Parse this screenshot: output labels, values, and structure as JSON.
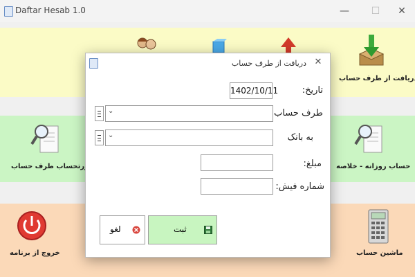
{
  "window": {
    "title": "Daftar Hesab 1.0",
    "minimize_glyph": "—",
    "maximize_glyph": "☐",
    "close_glyph": "✕"
  },
  "tiles": {
    "receive_from_party": "دریافت از طرف حساب",
    "party_statement": "صورتحساب طرف حساب",
    "daily_account_summary": "حساب روزانه - خلاصه",
    "exit_program": "خروج از برنامه",
    "calculator": "ماشین حساب"
  },
  "dialog": {
    "title": "دریافت از طرف حساب",
    "close_glyph": "✕",
    "fields": {
      "date_label": "تاریخ:",
      "date_value": "1402/10/11",
      "party_label": "طرف حساب:",
      "party_value": "",
      "bank_label": "به بانک",
      "bank_value": "",
      "amount_label": "مبلغ:",
      "amount_value": "",
      "receipt_no_label": "شماره  فیش:",
      "receipt_no_value": ""
    },
    "dropdown_glyph": "⌄",
    "buttons": {
      "cancel": "لغو",
      "submit": "ثبت"
    }
  },
  "colors": {
    "yellow_band": "#fbfbc6",
    "green_band": "#cbf5c4",
    "orange_band": "#fbd9b8",
    "submit_button": "#c8f5c0",
    "cancel_icon": "#d9473f"
  },
  "icons": [
    "app-icon",
    "minimize-icon",
    "maximize-icon",
    "close-icon",
    "download-box-icon",
    "users-icon",
    "cube-icon",
    "red-arrow-icon",
    "magnifier-document-icon",
    "power-icon",
    "calculator-icon",
    "chevron-down-icon",
    "list-icon",
    "cancel-icon",
    "save-icon"
  ]
}
